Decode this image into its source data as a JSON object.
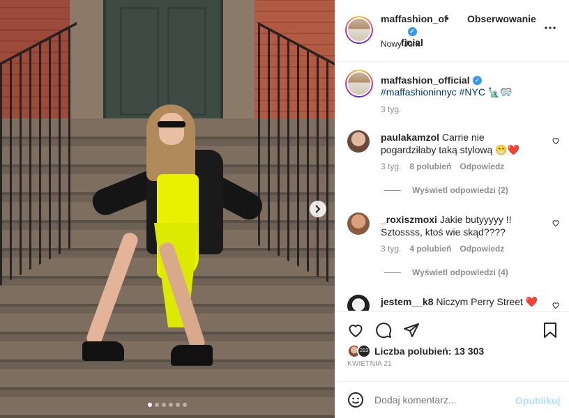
{
  "photo": {
    "carousel_dots": 6,
    "active_dot": 0
  },
  "header": {
    "username_line1": "maffashion_of",
    "username_line2": "ficial",
    "follow_status": "Obserwowanie",
    "separator": "•",
    "location": "Nowy Jork",
    "more_icon": "more-horizontal-icon"
  },
  "caption": {
    "username": "maffashion_official",
    "text": "#maffashioninnyc #NYC 🗽🥽",
    "time": "3 tyg."
  },
  "comments": [
    {
      "username": "paulakamzol",
      "text": "Carrie nie pogardziłaby taką stylową 😁❤️",
      "time": "3 tyg.",
      "likes": "8 polubień",
      "reply": "Odpowiedz",
      "view_replies": "Wyświetl odpowiedzi (2)"
    },
    {
      "username": "_roxiszmoxi",
      "text": "Jakie butyyyyy !! Sztossss, ktoś wie skąd????",
      "time": "3 tyg.",
      "likes": "4 polubień",
      "reply": "Odpowiedz",
      "view_replies": "Wyświetl odpowiedzi (4)"
    },
    {
      "username": "jestem__k8",
      "text": "Niczym Perry Street ❤️"
    }
  ],
  "actions": {
    "likes_label": "Liczba polubień: 13 303",
    "date": "KWIETNIA 21",
    "extra_likers_badge": "213"
  },
  "add_comment": {
    "placeholder": "Dodaj komentarz...",
    "publish": "Opublikuj"
  },
  "colors": {
    "verified": "#3897f0",
    "link": "#00376b",
    "muted": "#8e8e8e",
    "publish_disabled": "#b2dffc",
    "heart_red": "#ed4956"
  }
}
